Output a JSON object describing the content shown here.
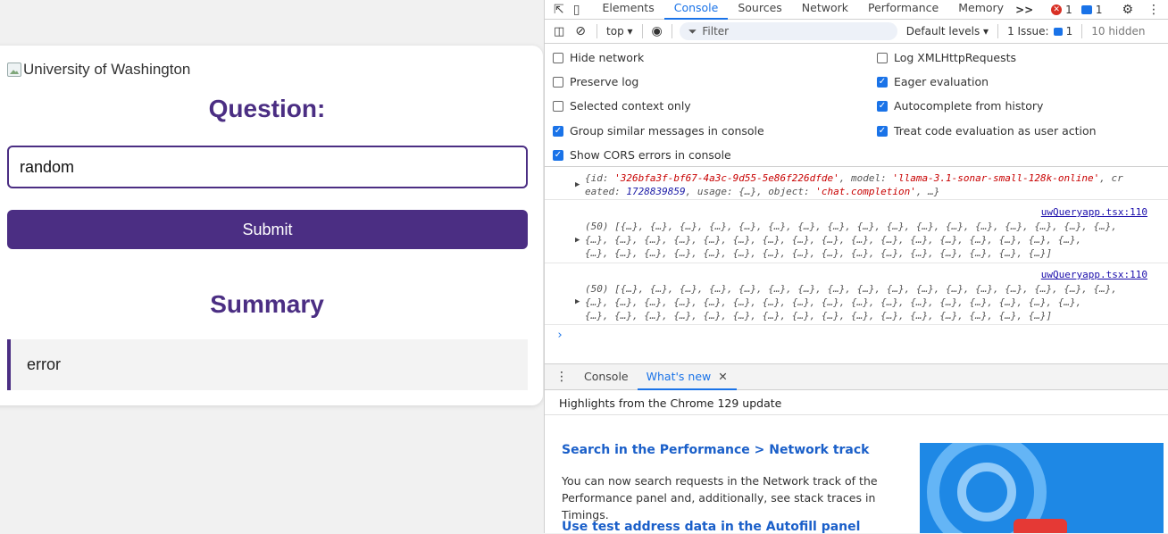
{
  "app": {
    "logo_alt": "University of Washington",
    "question_title": "Question:",
    "question_value": "random",
    "submit_label": "Submit",
    "summary_title": "Summary",
    "summary_text": "error",
    "accent_color": "#4b2e83"
  },
  "devtools": {
    "tabs": [
      "Elements",
      "Console",
      "Sources",
      "Network",
      "Performance",
      "Memory"
    ],
    "active_tab": "Console",
    "more_tabs": ">>",
    "errors_count": "1",
    "messages_count": "1",
    "toolbar": {
      "context": "top",
      "filter_placeholder": "Filter",
      "levels": "Default levels",
      "issues_label": "1 Issue:",
      "issues_count": "1",
      "hidden": "10 hidden"
    },
    "settings": {
      "left": [
        "Hide network",
        "Preserve log",
        "Selected context only",
        "Group similar messages in console",
        "Show CORS errors in console"
      ],
      "left_checked": [
        false,
        false,
        false,
        true,
        true
      ],
      "right": [
        "Log XMLHttpRequests",
        "Eager evaluation",
        "Autocomplete from history",
        "Treat code evaluation as user action"
      ],
      "right_checked": [
        false,
        true,
        true,
        true
      ]
    },
    "log": {
      "entry1_line1_pre": "{id: ",
      "entry1_id": "'326bfa3f-bf67-4a3c-9d55-5e86f226dfde'",
      "entry1_mid": ", model: ",
      "entry1_model": "'llama-3.1-sonar-small-128k-online'",
      "entry1_tail": ", cr",
      "entry1_line2_pre": "eated: ",
      "entry1_created": "1728839859",
      "entry1_line2_post": ", usage: {…}, object: ",
      "entry1_object": "'chat.completion'",
      "entry1_end": ", …}",
      "source": "uwQueryapp.tsx:110",
      "array_line1": "(50) [{…}, {…}, {…}, {…}, {…}, {…}, {…}, {…}, {…}, {…}, {…}, {…}, {…}, {…}, {…}, {…}, {…},",
      "array_line2": "{…}, {…}, {…}, {…}, {…}, {…}, {…}, {…}, {…}, {…}, {…}, {…}, {…}, {…}, {…}, {…}, {…},",
      "array_line3": "{…}, {…}, {…}, {…}, {…}, {…}, {…}, {…}, {…}, {…}, {…}, {…}, {…}, {…}, {…}, {…}]"
    },
    "drawer": {
      "tabs": [
        "Console",
        "What's new"
      ],
      "highlights": "Highlights from the Chrome 129 update",
      "h1": "Search in the Performance > Network track",
      "p1": "You can now search requests in the Network track of the Performance panel and, additionally, see stack traces in Timings.",
      "h2": "Use test address data in the Autofill panel"
    }
  }
}
